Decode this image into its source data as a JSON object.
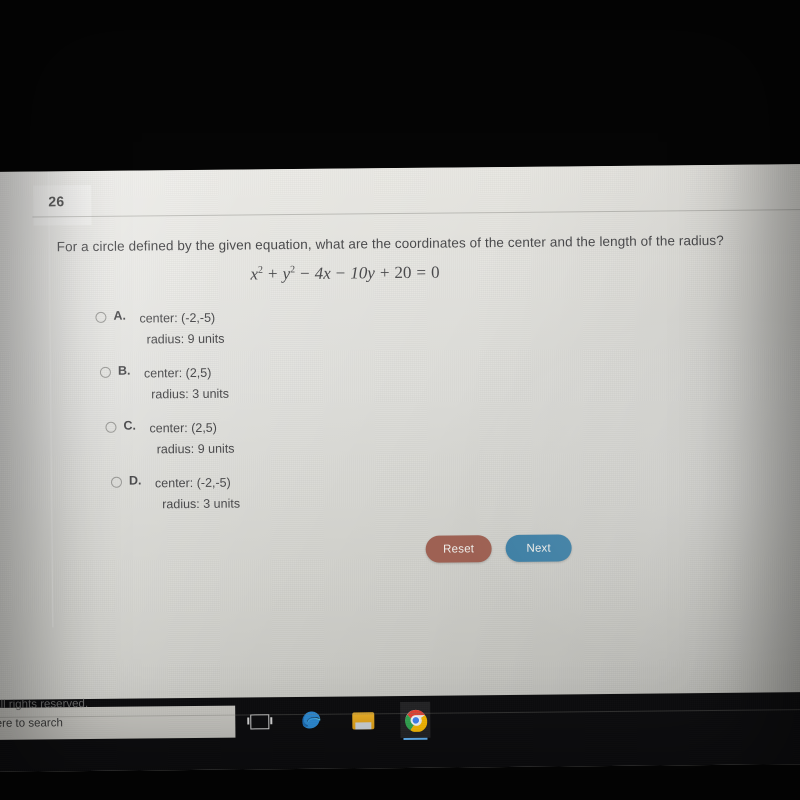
{
  "quiz": {
    "question_number": "26",
    "question_text": "For a circle defined by the given equation, what are the coordinates of the center and the length of the radius?",
    "equation": {
      "x_var": "x",
      "x_exp": "2",
      "plus1": "+",
      "y_var": "y",
      "y_exp": "2",
      "minus1": "−",
      "term_4x": "4x",
      "minus2": "−",
      "term_10y": "10y",
      "plus2": "+",
      "constant": "20",
      "equals": "=",
      "rhs": "0",
      "plain": "x2 + y2 − 4x − 10y + 20 = 0"
    },
    "options": [
      {
        "letter": "A.",
        "line1": "center: (-2,-5)",
        "line2": "radius: 9 units",
        "selected": false
      },
      {
        "letter": "B.",
        "line1": "center: (2,5)",
        "line2": "radius: 3 units",
        "selected": false
      },
      {
        "letter": "C.",
        "line1": "center: (2,5)",
        "line2": "radius: 9 units",
        "selected": false
      },
      {
        "letter": "D.",
        "line1": "center: (-2,-5)",
        "line2": "radius: 3 units",
        "selected": false
      }
    ],
    "buttons": {
      "reset_label": "Reset",
      "next_label": "Next",
      "reset_color": "#9e6153",
      "next_color": "#3d7fa5"
    },
    "footer_text": ". All rights reserved."
  },
  "taskbar": {
    "search_placeholder": "here to search",
    "items": [
      {
        "name": "task-view",
        "label": "Task View"
      },
      {
        "name": "edge",
        "label": "Microsoft Edge"
      },
      {
        "name": "explorer",
        "label": "File Explorer"
      },
      {
        "name": "chrome",
        "label": "Google Chrome"
      }
    ],
    "active_item": "chrome",
    "active_indicator_color": "#64b5f6"
  }
}
